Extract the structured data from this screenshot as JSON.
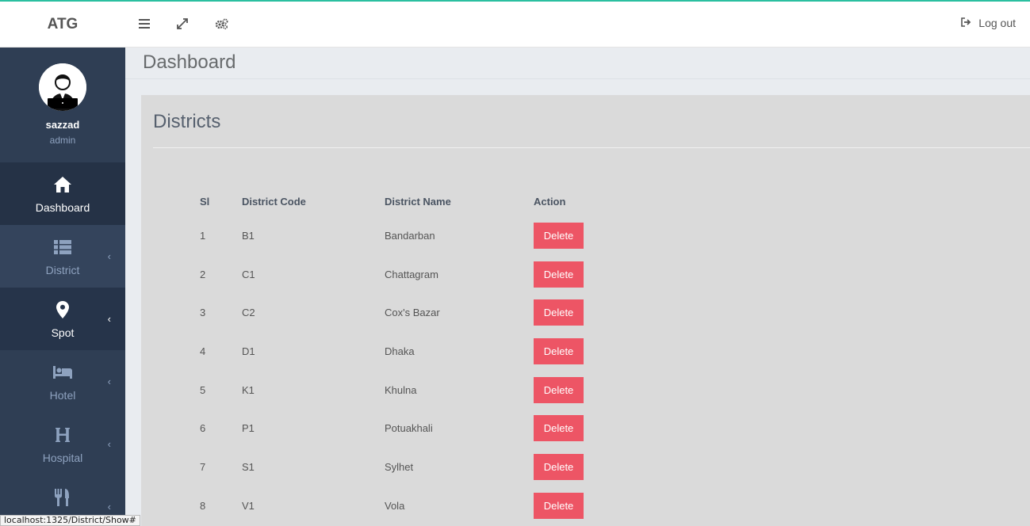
{
  "app": {
    "brand": "ATG"
  },
  "topbar": {
    "logout_label": "Log out"
  },
  "user": {
    "name": "sazzad",
    "role": "admin"
  },
  "sidebar": {
    "items": [
      {
        "label": "Dashboard",
        "icon": "home-icon"
      },
      {
        "label": "District",
        "icon": "list-icon"
      },
      {
        "label": "Spot",
        "icon": "map-pin-icon"
      },
      {
        "label": "Hotel",
        "icon": "bed-icon"
      },
      {
        "label": "Hospital",
        "icon": "hospital-icon"
      },
      {
        "label": "",
        "icon": "utensils-icon"
      }
    ]
  },
  "page": {
    "title": "Dashboard"
  },
  "districts": {
    "title": "Districts",
    "columns": [
      "Sl",
      "District Code",
      "District Name",
      "Action"
    ],
    "delete_label": "Delete",
    "rows": [
      {
        "sl": "1",
        "code": "B1",
        "name": "Bandarban"
      },
      {
        "sl": "2",
        "code": "C1",
        "name": "Chattagram"
      },
      {
        "sl": "3",
        "code": "C2",
        "name": "Cox's Bazar"
      },
      {
        "sl": "4",
        "code": "D1",
        "name": "Dhaka"
      },
      {
        "sl": "5",
        "code": "K1",
        "name": "Khulna"
      },
      {
        "sl": "6",
        "code": "P1",
        "name": "Potuakhali"
      },
      {
        "sl": "7",
        "code": "S1",
        "name": "Sylhet"
      },
      {
        "sl": "8",
        "code": "V1",
        "name": "Vola"
      }
    ]
  },
  "status_bar": {
    "url": "localhost:1325/District/Show#"
  },
  "colors": {
    "accent": "#2bbfa0",
    "sidebar": "#2f3e54",
    "danger": "#ed5565"
  }
}
